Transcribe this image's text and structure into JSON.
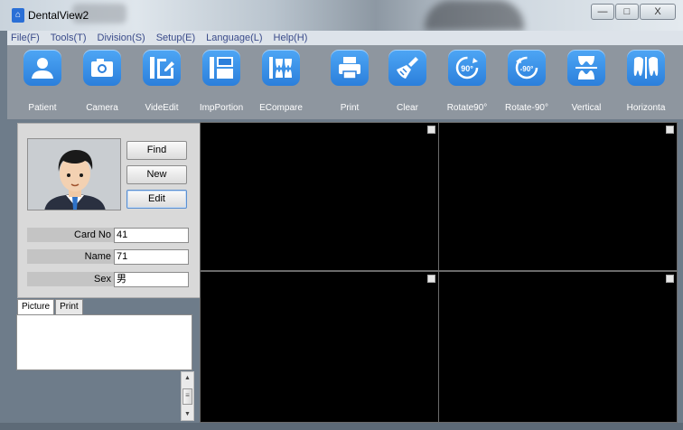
{
  "window": {
    "title": "DentalView2",
    "minimize": "—",
    "maximize": "□",
    "close": "X"
  },
  "menu": [
    "File(F)",
    "Tools(T)",
    "Division(S)",
    "Setup(E)",
    "Language(L)",
    "Help(H)"
  ],
  "toolbar": [
    {
      "label": "Patient",
      "icon": "user-icon"
    },
    {
      "label": "Camera",
      "icon": "camera-icon"
    },
    {
      "label": "VideEdit",
      "icon": "edit-icon"
    },
    {
      "label": "ImpPortion",
      "icon": "layout-icon"
    },
    {
      "label": "ECompare",
      "icon": "compare-teeth-icon"
    },
    {
      "label": "Print",
      "icon": "printer-icon"
    },
    {
      "label": "Clear",
      "icon": "broom-icon"
    },
    {
      "label": "Rotate90°",
      "icon": "rotate-cw-icon"
    },
    {
      "label": "Rotate-90°",
      "icon": "rotate-ccw-icon"
    },
    {
      "label": "Vertical",
      "icon": "flip-vertical-icon"
    },
    {
      "label": "Horizonta",
      "icon": "flip-horizontal-icon"
    }
  ],
  "patient": {
    "buttons": {
      "find": "Find",
      "new": "New",
      "edit": "Edit"
    },
    "fields": [
      {
        "label": "Card No",
        "value": "41"
      },
      {
        "label": "Name",
        "value": "71"
      },
      {
        "label": "Sex",
        "value": "男"
      }
    ]
  },
  "tabs": [
    {
      "label": "Picture"
    },
    {
      "label": "Print"
    }
  ],
  "colors": {
    "accent": "#2b7fdb",
    "toolbar": "#8e969f",
    "background": "#6e7c8a",
    "menu_text": "#3a4b8a"
  }
}
